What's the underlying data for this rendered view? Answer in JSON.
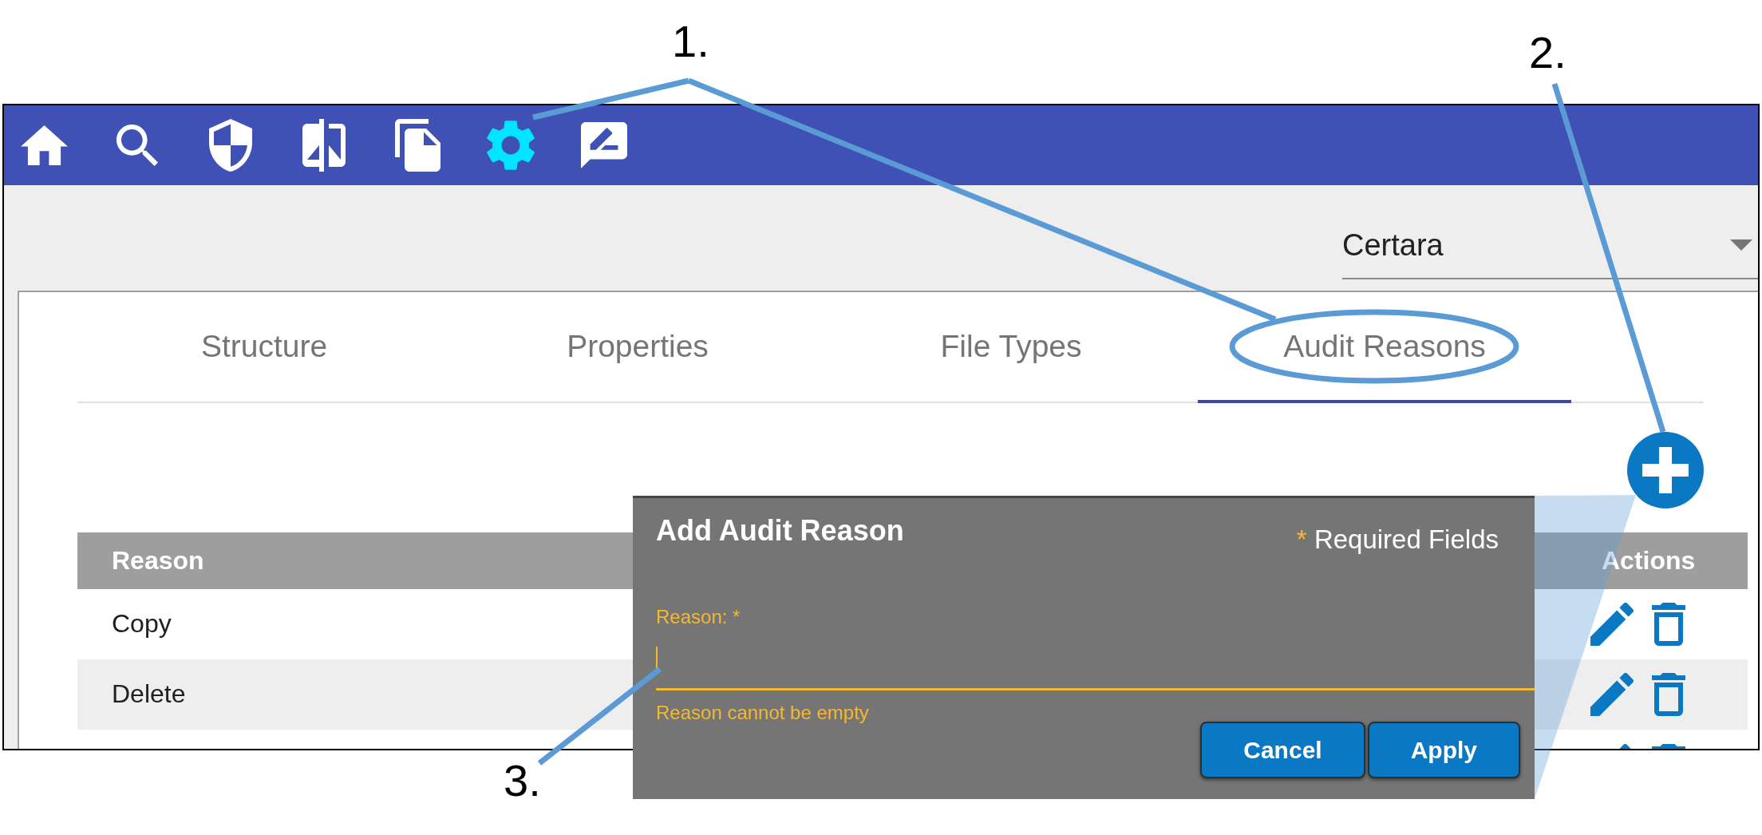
{
  "callouts": [
    {
      "number": "1."
    },
    {
      "number": "2."
    },
    {
      "number": "3."
    }
  ],
  "toolbar": {
    "items": [
      {
        "selected": false
      },
      {
        "selected": false
      },
      {
        "selected": false
      },
      {
        "selected": false
      },
      {
        "selected": false
      },
      {
        "selected": true
      },
      {
        "selected": false
      }
    ]
  },
  "organization_select": {
    "value": "Certara"
  },
  "tabs": [
    {
      "label": "Structure",
      "selected": false
    },
    {
      "label": "Properties",
      "selected": false
    },
    {
      "label": "File Types",
      "selected": false
    },
    {
      "label": "Audit Reasons",
      "selected": true
    }
  ],
  "table": {
    "columns": [
      "Reason",
      "Actions"
    ],
    "rows": [
      {
        "kind": "full",
        "reason": "Copy"
      },
      {
        "kind": "full",
        "reason": "Delete"
      },
      {
        "kind": "cut_off"
      }
    ]
  },
  "dialog": {
    "title": "Add Audit Reason",
    "required_mark": "*",
    "required_label": "Required Fields",
    "field": {
      "label": "Reason: *",
      "focused": true,
      "error": "Reason cannot be empty"
    },
    "buttons": [
      "Cancel",
      "Apply"
    ]
  }
}
